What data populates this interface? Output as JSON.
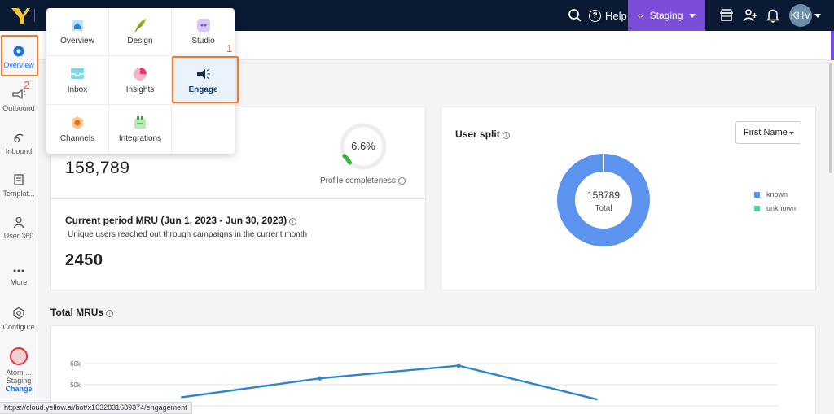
{
  "topbar": {
    "help_label": "Help",
    "env_label": "Staging",
    "avatar_initials": "KHV"
  },
  "sidebar": {
    "items": [
      {
        "label": "Overview",
        "icon": "eye-icon"
      },
      {
        "label": "Outbound",
        "icon": "megaphone-icon"
      },
      {
        "label": "Inbound",
        "icon": "inbound-icon"
      },
      {
        "label": "Templat...",
        "icon": "template-icon"
      },
      {
        "label": "User 360",
        "icon": "user-icon"
      },
      {
        "label": "More",
        "icon": "more-dots-icon"
      },
      {
        "label": "Configure",
        "icon": "configure-icon"
      }
    ],
    "bot_name": "Atom ...",
    "bot_env": "Staging",
    "change_label": "Change",
    "annotation_2": "2"
  },
  "menu": {
    "items": [
      {
        "label": "Overview",
        "icon": "home-icon"
      },
      {
        "label": "Design",
        "icon": "feather-icon"
      },
      {
        "label": "Studio",
        "icon": "studio-icon"
      },
      {
        "label": "Inbox",
        "icon": "inbox-icon"
      },
      {
        "label": "Insights",
        "icon": "pie-chart-icon"
      },
      {
        "label": "Engage",
        "icon": "megaphone-icon"
      },
      {
        "label": "Channels",
        "icon": "channels-icon"
      },
      {
        "label": "Integrations",
        "icon": "integrations-icon"
      }
    ],
    "annotation_1": "1"
  },
  "users_card": {
    "total_users": "158,789",
    "completeness_value": "6.6%",
    "completeness_fraction": 0.066,
    "completeness_label": "Profile completeness",
    "mru_title": "Current period MRU (Jun 1, 2023 - Jun 30, 2023)",
    "mru_subtitle": "Unique users reached out through campaigns in the current month",
    "mru_value": "2450"
  },
  "user_split": {
    "title": "User split",
    "select_value": "First Name",
    "center_value": "158789",
    "center_label": "Total",
    "legend": [
      {
        "name": "known",
        "color": "#5b93ef"
      },
      {
        "name": "unknown",
        "color": "#4fd1a8"
      }
    ]
  },
  "total_mrus": {
    "title": "Total MRUs"
  },
  "chart_data": {
    "type": "line",
    "y_ticks": [
      "60k",
      "50k"
    ],
    "y_tick_values": [
      60000,
      50000
    ],
    "points": [
      {
        "x": 1,
        "y": 44000
      },
      {
        "x": 2,
        "y": 53000
      },
      {
        "x": 3,
        "y": 59000
      },
      {
        "x": 4,
        "y": 43000
      }
    ],
    "xlim": [
      0.3,
      5.3
    ],
    "ylim": [
      39000,
      63000
    ],
    "color": "#2e86c8"
  },
  "status_url": "https://cloud.yellow.ai/bot/x1632831689374/engagement"
}
